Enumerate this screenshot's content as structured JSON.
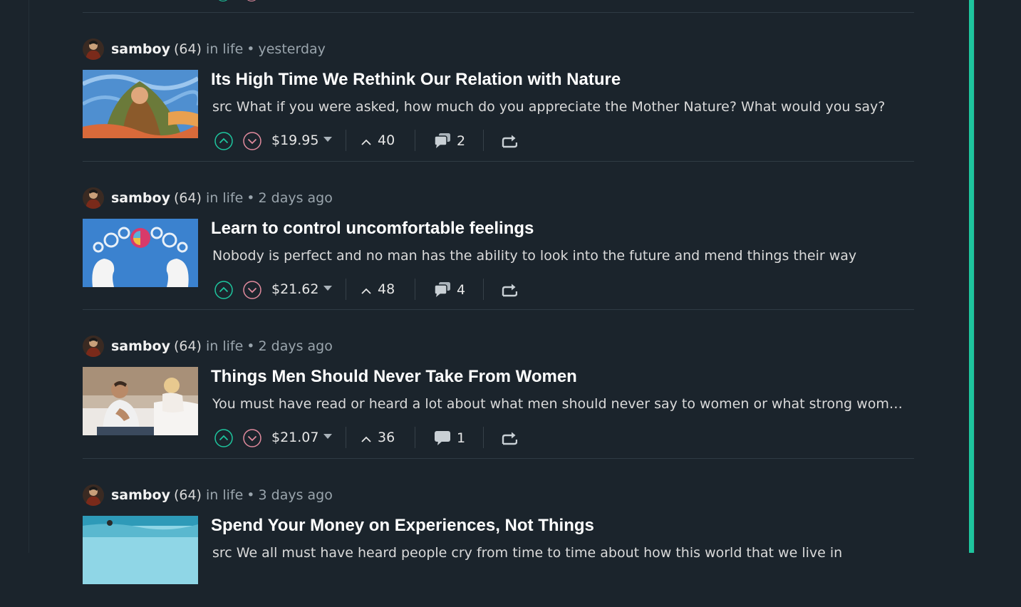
{
  "colors": {
    "background": "#1b242c",
    "accent": "#1ec59e",
    "upvote": "#1ec59e",
    "downvote": "#e08a9d",
    "muted_text": "#9aa5ad",
    "divider": "#2f3b44"
  },
  "icons": {
    "upvote": "chevron-up-circle-icon",
    "downvote": "chevron-down-circle-icon",
    "payout_dropdown": "caret-down-icon",
    "votes": "chevron-up-icon",
    "comments": "speech-bubbles-icon",
    "reblog": "reblog-icon"
  },
  "posts": [
    {
      "author": "samboy",
      "reputation": "(64)",
      "category": "in life",
      "separator": "•",
      "time": "yesterday",
      "title": "Its High Time We Rethink Our Relation with Nature",
      "excerpt": "src What if you were asked, how much do you appreciate the Mother Nature? What would you say?",
      "payout": "$19.95",
      "votes": "40",
      "comments": "2"
    },
    {
      "author": "samboy",
      "reputation": "(64)",
      "category": "in life",
      "separator": "•",
      "time": "2 days ago",
      "title": "Learn to control uncomfortable feelings",
      "excerpt": "Nobody is perfect and no man has the ability to look into the future and mend things their way",
      "payout": "$21.62",
      "votes": "48",
      "comments": "4"
    },
    {
      "author": "samboy",
      "reputation": "(64)",
      "category": "in life",
      "separator": "•",
      "time": "2 days ago",
      "title": "Things Men Should Never Take From Women",
      "excerpt": "You must have read or heard a lot about what men should never say to women or what strong women do",
      "payout": "$21.07",
      "votes": "36",
      "comments": "1"
    },
    {
      "author": "samboy",
      "reputation": "(64)",
      "category": "in life",
      "separator": "•",
      "time": "3 days ago",
      "title": "Spend Your Money on Experiences, Not Things",
      "excerpt": "src We all must have heard people cry from time to time about how this world that we live in"
    }
  ]
}
